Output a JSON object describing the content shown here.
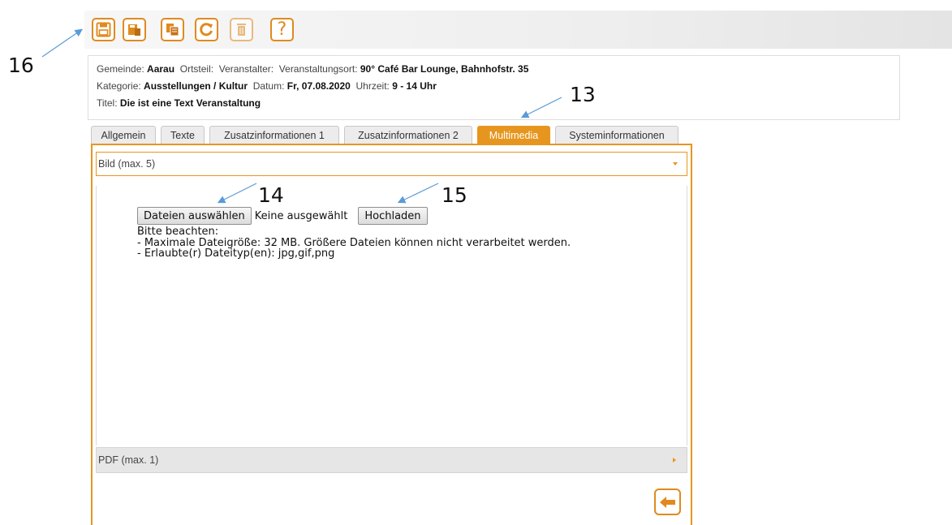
{
  "toolbar": {
    "buttons": [
      {
        "icon": "save-icon"
      },
      {
        "icon": "save-close-icon"
      },
      {
        "icon": "copy-icon"
      },
      {
        "icon": "refresh-icon"
      },
      {
        "icon": "delete-icon"
      },
      {
        "icon": "help-icon",
        "label": "?"
      }
    ]
  },
  "info": {
    "gemeinde_label": "Gemeinde:",
    "gemeinde_value": "Aarau",
    "ortsteil_label": "Ortsteil:",
    "veranstalter_label": "Veranstalter:",
    "ort_label": "Veranstaltungsort:",
    "ort_value": "90° Café Bar Lounge, Bahnhofstr. 35",
    "kategorie_label": "Kategorie:",
    "kategorie_value": "Ausstellungen / Kultur",
    "datum_label": "Datum:",
    "datum_value": "Fr, 07.08.2020",
    "uhrzeit_label": "Uhrzeit:",
    "uhrzeit_value": "9 - 14 Uhr",
    "titel_label": "Titel:",
    "titel_value": "Die ist eine Text Veranstaltung"
  },
  "tabs": [
    {
      "label": "Allgemein",
      "active": false
    },
    {
      "label": "Texte",
      "active": false
    },
    {
      "label": "Zusatzinformationen 1",
      "active": false
    },
    {
      "label": "Zusatzinformationen 2",
      "active": false
    },
    {
      "label": "Multimedia",
      "active": true
    },
    {
      "label": "Systeminformationen",
      "active": false
    }
  ],
  "bild": {
    "header": "Bild (max. 5)",
    "choose_button": "Dateien auswählen",
    "file_status": "Keine ausgewählt",
    "upload_button": "Hochladen",
    "note_title": "Bitte beachten:",
    "note_size": "- Maximale Dateigröße: 32 MB. Größere Dateien können nicht verarbeitet werden.",
    "note_types": "- Erlaubte(r) Dateityp(en): jpg,gif,png"
  },
  "pdf": {
    "header": "PDF (max. 1)"
  },
  "callouts": {
    "c13": "13",
    "c14": "14",
    "c15": "15",
    "c16": "16"
  },
  "colors": {
    "accent": "#e6961f",
    "arrow": "#5b9bd5"
  }
}
